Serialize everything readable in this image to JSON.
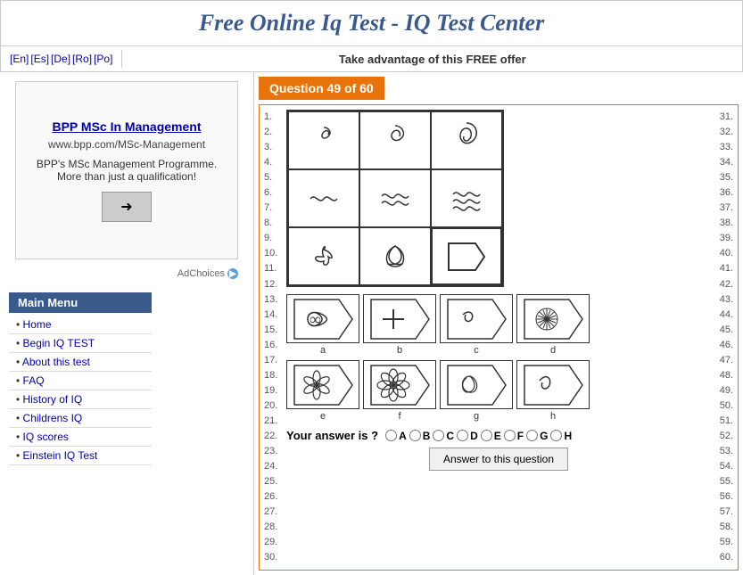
{
  "header": {
    "title": "Free Online Iq Test - IQ Test Center"
  },
  "langBar": {
    "languages": [
      "En",
      "Es",
      "De",
      "Ro",
      "Po"
    ],
    "offer": "Take advantage of this FREE offer"
  },
  "sidebar": {
    "adBox": {
      "title": "BPP MSc In Management",
      "url": "www.bpp.com/MSc-Management",
      "description": "BPP's MSc Management Programme. More than just a qualification!",
      "buttonLabel": "→",
      "adChoices": "AdChoices"
    },
    "menuTitle": "Main Menu",
    "menuItems": [
      {
        "label": "Home",
        "href": "#"
      },
      {
        "label": "Begin IQ TEST",
        "href": "#"
      },
      {
        "label": "About this test",
        "href": "#"
      },
      {
        "label": "FAQ",
        "href": "#"
      },
      {
        "label": "History of IQ",
        "href": "#"
      },
      {
        "label": "Childrens IQ",
        "href": "#"
      },
      {
        "label": "IQ scores",
        "href": "#"
      },
      {
        "label": "Einstein IQ Test",
        "href": "#"
      }
    ]
  },
  "question": {
    "header": "Question 49 of 60",
    "numbersLeft": [
      "1.",
      "2.",
      "3.",
      "4.",
      "5.",
      "6.",
      "7.",
      "8.",
      "9.",
      "10.",
      "11.",
      "12.",
      "13.",
      "14.",
      "15.",
      "16.",
      "17.",
      "18.",
      "19.",
      "20.",
      "21.",
      "22.",
      "23.",
      "24.",
      "25.",
      "26.",
      "27.",
      "28.",
      "29.",
      "30."
    ],
    "numbersRight": [
      "31.",
      "32.",
      "33.",
      "34.",
      "35.",
      "36.",
      "37.",
      "38.",
      "39.",
      "40.",
      "41.",
      "42.",
      "43.",
      "44.",
      "45.",
      "46.",
      "47.",
      "48.",
      "49.",
      "50.",
      "51.",
      "52.",
      "53.",
      "54.",
      "55.",
      "56.",
      "57.",
      "58.",
      "59.",
      "60."
    ],
    "optionLabels": [
      "a",
      "b",
      "c",
      "d"
    ],
    "optionLabels2": [
      "e",
      "f",
      "g",
      "h"
    ],
    "answerLabel": "Your answer is ?",
    "radioOptions": [
      "A",
      "B",
      "C",
      "D",
      "E",
      "F",
      "G",
      "H"
    ],
    "submitLabel": "Answer to this question"
  }
}
